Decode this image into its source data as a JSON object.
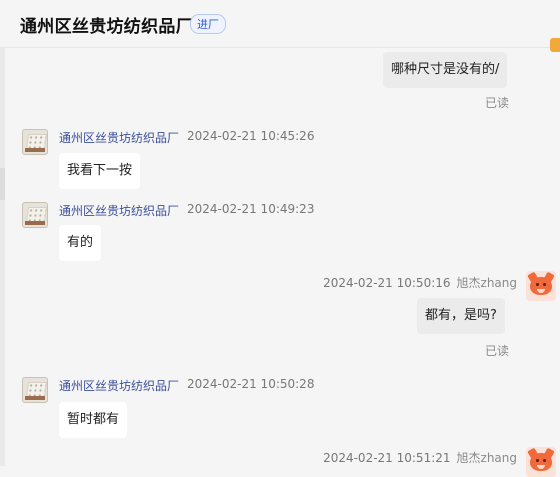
{
  "header": {
    "title": "通州区丝贵坊纺织品厂",
    "badge": "进厂"
  },
  "messages": [
    {
      "text": "哪种尺寸是没有的/",
      "status": "已读"
    },
    {
      "sender": "通州区丝贵坊纺织品厂",
      "time": "2024-02-21 10:45:26",
      "text": "我看下一按"
    },
    {
      "sender": "通州区丝贵坊纺织品厂",
      "time": "2024-02-21 10:49:23",
      "text": "有的"
    },
    {
      "sender": "旭杰zhang",
      "time": "2024-02-21 10:50:16",
      "text": "都有，是吗?",
      "status": "已读"
    },
    {
      "sender": "通州区丝贵坊纺织品厂",
      "time": "2024-02-21 10:50:28",
      "text": "暂时都有"
    },
    {
      "sender": "旭杰zhang",
      "time": "2024-02-21 10:51:21"
    }
  ]
}
